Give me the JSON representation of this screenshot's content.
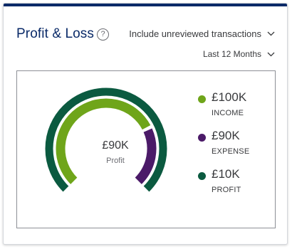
{
  "header": {
    "title": "Profit & Loss",
    "help_glyph": "?",
    "review_filter": "Include unreviewed transactions",
    "date_range": "Last 12 Months"
  },
  "colors": {
    "title": "#0a2a68",
    "income": "#6fa51a",
    "expense": "#4b1a68",
    "profit": "#0b5a40"
  },
  "chart_data": {
    "type": "donut",
    "center": {
      "value": "£90K",
      "label": "Profit"
    },
    "series": [
      {
        "name": "INCOME",
        "display": "£100K",
        "value": 100000,
        "color": "#6fa51a"
      },
      {
        "name": "EXPENSE",
        "display": "£90K",
        "value": 90000,
        "color": "#4b1a68"
      },
      {
        "name": "PROFIT",
        "display": "£10K",
        "value": 10000,
        "color": "#0b5a40"
      }
    ]
  },
  "icons": {
    "help": "question-circle-icon",
    "dropdown": "chevron-down-icon"
  }
}
